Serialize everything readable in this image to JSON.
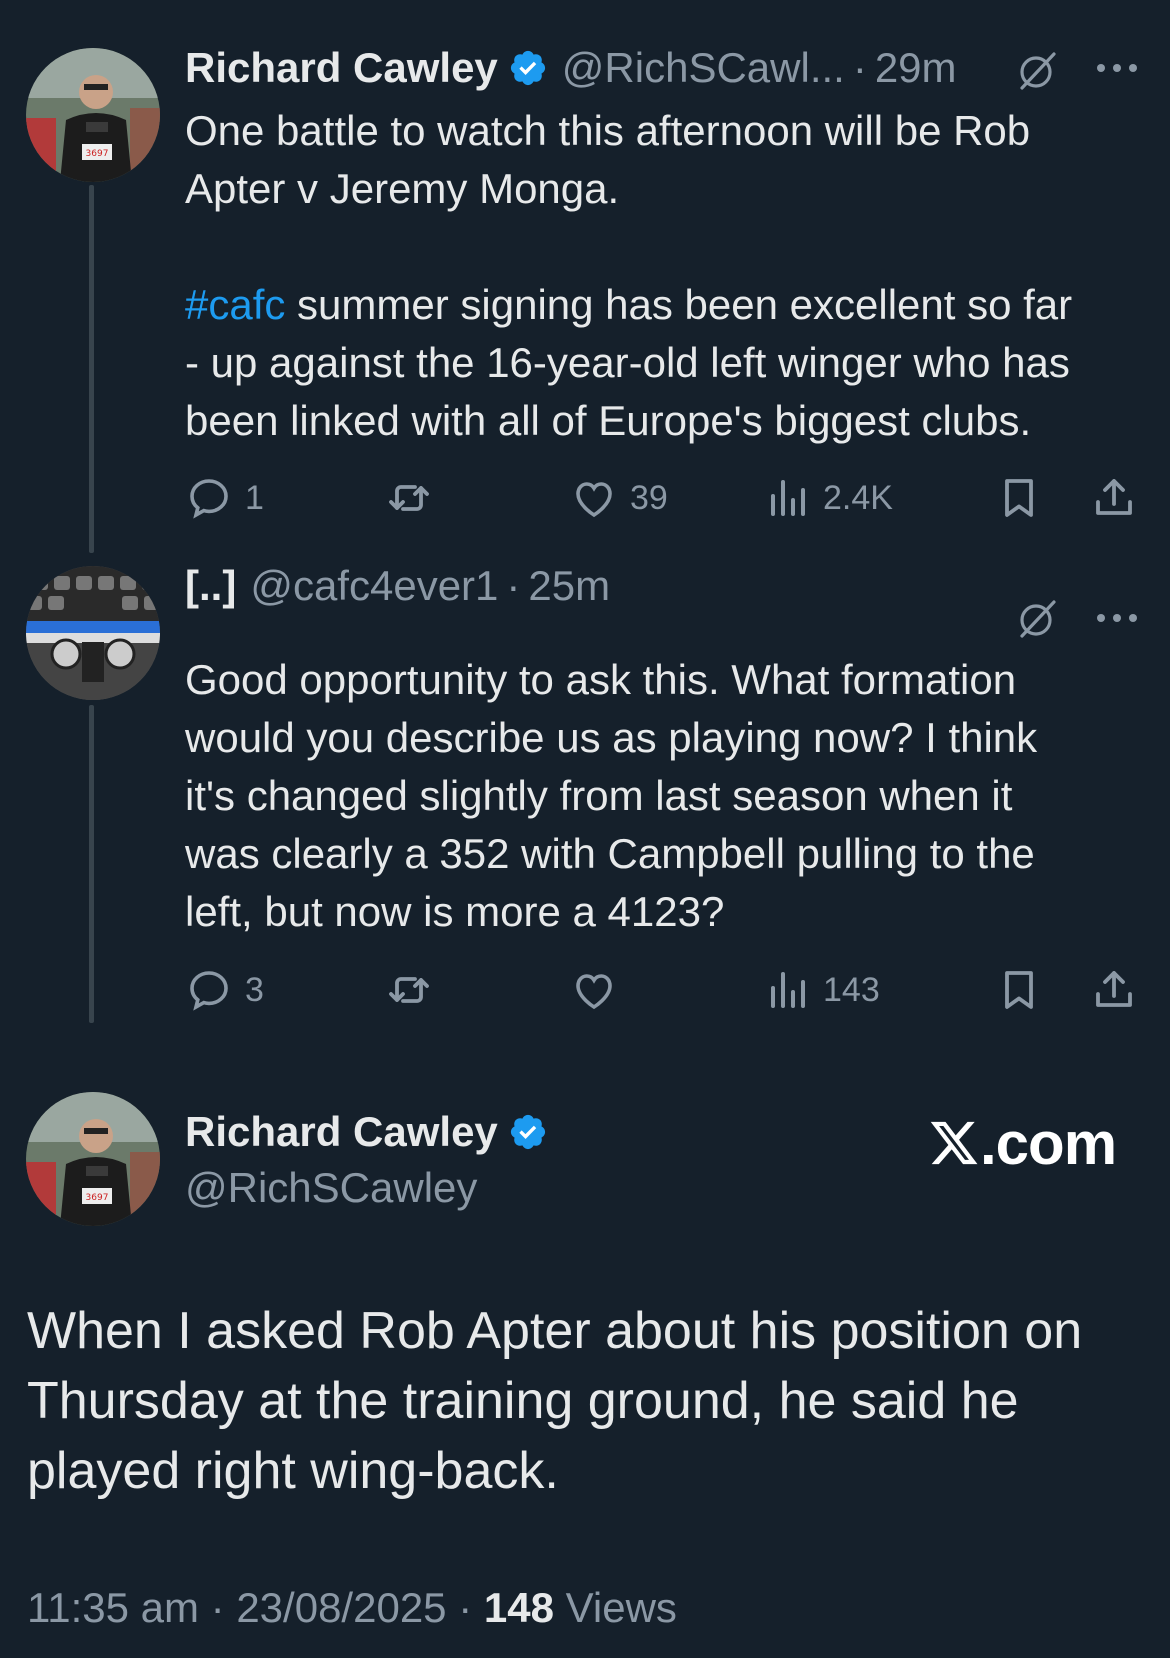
{
  "tweet1": {
    "author_name": "Richard Cawley",
    "handle": "@RichSCawl...",
    "separator": "·",
    "time": "29m",
    "hashtag": "#cafc",
    "text_line1": "One battle to watch this afternoon will be Rob",
    "text_line2": "Apter v Jeremy Monga.",
    "text_rest_line1": " summer signing has been excellent so far",
    "text_rest_line2": "- up against the 16-year-old left winger who has",
    "text_rest_line3": "been linked with all of Europe's biggest clubs.",
    "replies": "1",
    "likes": "39",
    "views": "2.4K"
  },
  "tweet2": {
    "author_name": "[..]",
    "handle": "@cafc4ever1",
    "separator": "·",
    "time": "25m",
    "text_line1": "Good opportunity to ask this.  What formation",
    "text_line2": "would you describe us as playing now?  I think",
    "text_line3": "it's changed slightly from last season when it",
    "text_line4": "was clearly a 352 with Campbell pulling to the",
    "text_line5": "left, but now is more a 4123?",
    "replies": "3",
    "views": "143"
  },
  "main_tweet": {
    "author_name": "Richard Cawley",
    "handle": "@RichSCawley",
    "logo_text": ".com",
    "text_line1": "When I asked Rob Apter about his position on",
    "text_line2": "Thursday at the training ground, he said he",
    "text_line3": "played right wing-back.",
    "time": "11:35 am",
    "separator": " · ",
    "date": "23/08/2025",
    "views_count": "148",
    "views_label": " Views"
  },
  "colors": {
    "background": "#15202b",
    "text": "#e7e9ea",
    "secondary": "#8b98a5",
    "accent": "#1d9bf0",
    "thread_line": "#38444d"
  },
  "icons": {
    "verified": "verified-badge-icon",
    "grok": "grok-icon",
    "more": "more-dots-icon",
    "reply": "reply-icon",
    "retweet": "retweet-icon",
    "like": "heart-icon",
    "views": "views-chart-icon",
    "bookmark": "bookmark-icon",
    "share": "share-icon"
  }
}
